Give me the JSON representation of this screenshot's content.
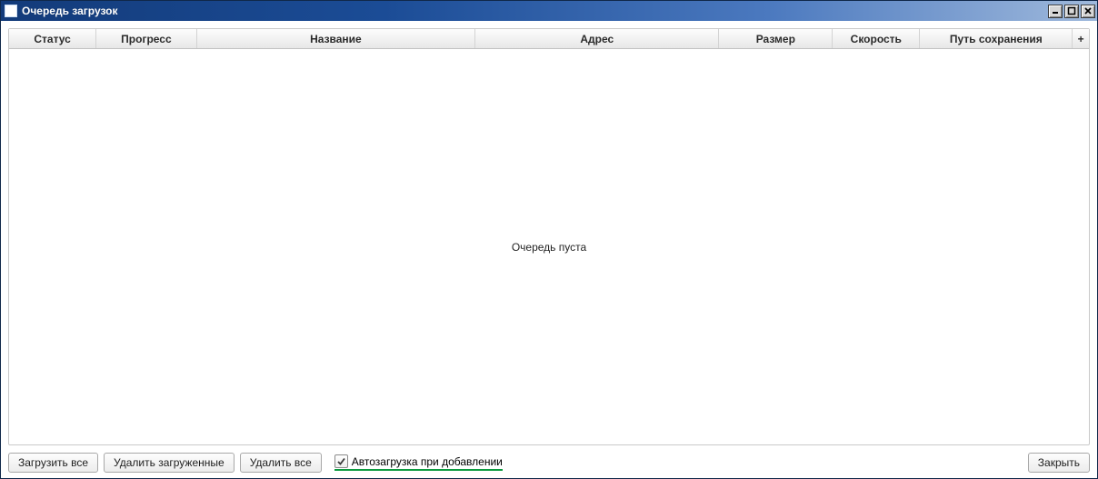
{
  "window": {
    "title": "Очередь загрузок"
  },
  "columns": {
    "status": "Статус",
    "progress": "Прогресс",
    "name": "Название",
    "addr": "Адрес",
    "size": "Размер",
    "speed": "Скорость",
    "path": "Путь сохранения",
    "add_glyph": "+"
  },
  "table": {
    "empty_text": "Очередь пуста"
  },
  "buttons": {
    "load_all": "Загрузить все",
    "delete_loaded": "Удалить загруженные",
    "delete_all": "Удалить все",
    "close": "Закрыть"
  },
  "options": {
    "autoload_label": "Автозагрузка при добавлении",
    "autoload_checked": true
  }
}
